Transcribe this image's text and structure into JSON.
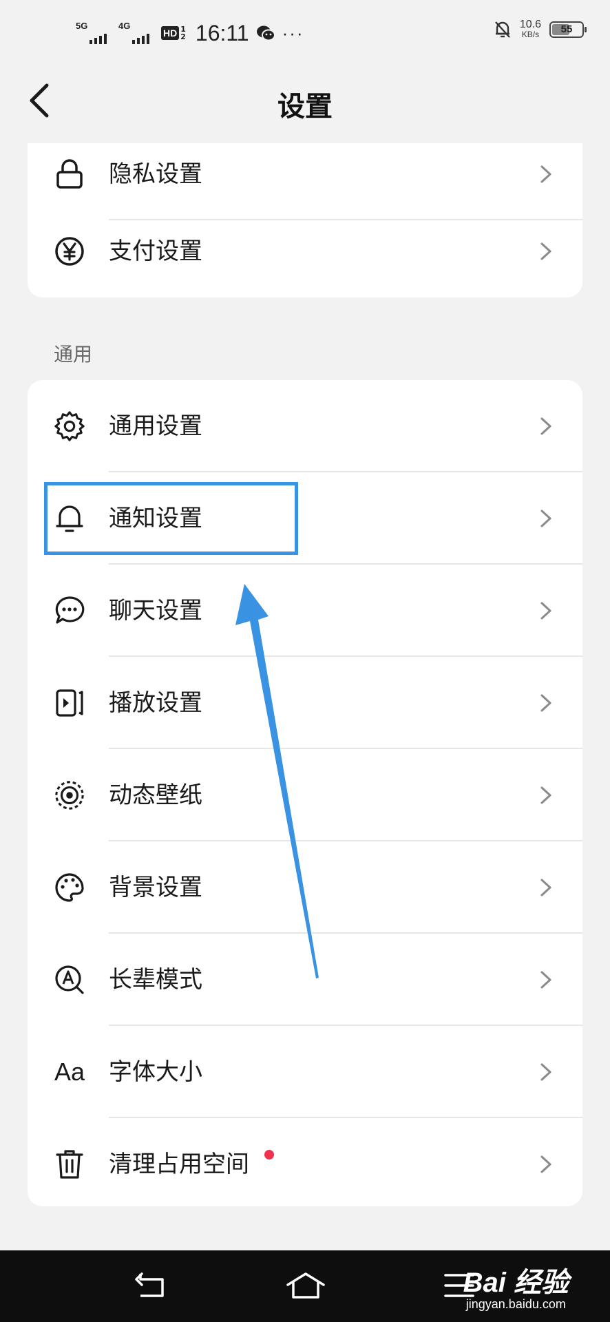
{
  "status_bar": {
    "net1": "5G",
    "net2": "4G",
    "hd": "HD",
    "hd_fraction_top": "1",
    "hd_fraction_bottom": "2",
    "time": "16:11",
    "more": "···",
    "speed_value": "10.6",
    "speed_unit": "KB/s",
    "battery": "55"
  },
  "header": {
    "title": "设置"
  },
  "top_group": [
    {
      "label": "隐私设置",
      "icon": "lock-icon"
    },
    {
      "label": "支付设置",
      "icon": "yen-icon"
    }
  ],
  "general_section": {
    "label": "通用",
    "items": [
      {
        "label": "通用设置",
        "icon": "gear-icon"
      },
      {
        "label": "通知设置",
        "icon": "bell-icon"
      },
      {
        "label": "聊天设置",
        "icon": "chat-bubble-icon"
      },
      {
        "label": "播放设置",
        "icon": "play-icon"
      },
      {
        "label": "动态壁纸",
        "icon": "dynamic-wallpaper-icon"
      },
      {
        "label": "背景设置",
        "icon": "palette-icon"
      },
      {
        "label": "长辈模式",
        "icon": "elder-mode-icon"
      },
      {
        "label": "字体大小",
        "icon": "font-size-icon",
        "icon_text": "Aa"
      },
      {
        "label": "清理占用空间",
        "icon": "trash-icon"
      }
    ]
  },
  "watermark": {
    "main": "Bai 经验",
    "sub": "jingyan.baidu.com"
  },
  "colors": {
    "highlight": "#3a93e2",
    "badge": "#f0324f"
  }
}
